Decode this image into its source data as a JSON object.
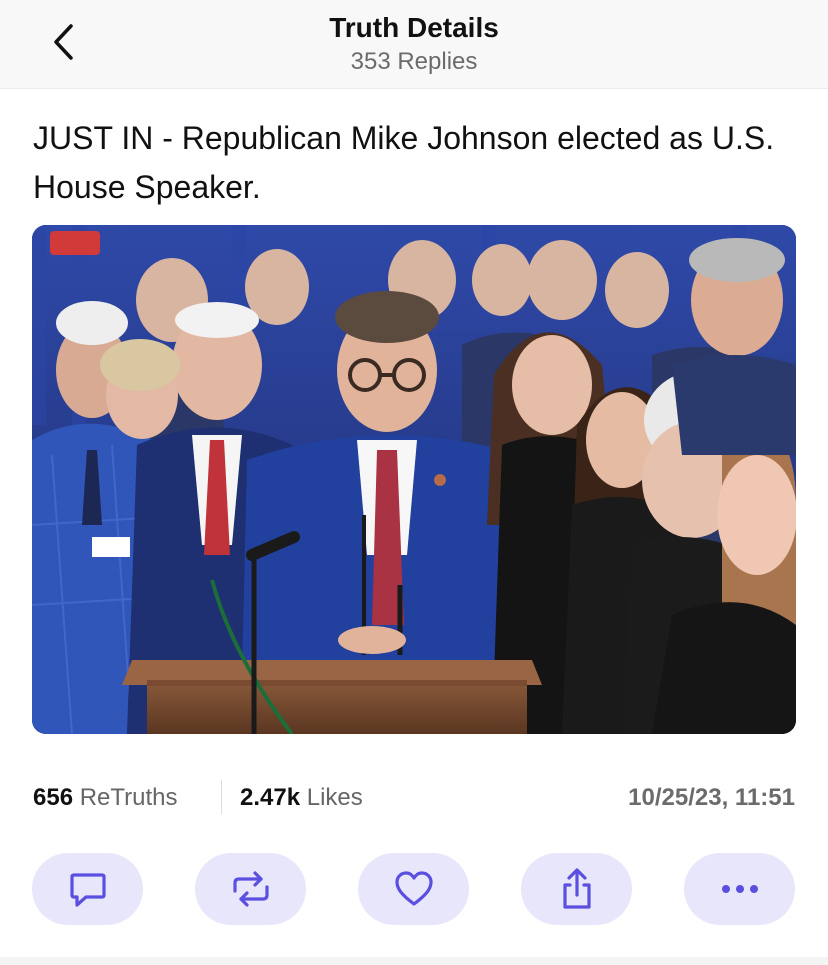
{
  "header": {
    "title": "Truth Details",
    "subtitle": "353 Replies",
    "back_icon": "chevron-left-icon"
  },
  "post": {
    "text": "JUST IN - Republican Mike Johnson elected as U.S. House Speaker.",
    "image_subject": "photo"
  },
  "stats": {
    "retruths_count": "656",
    "retruths_label": "ReTruths",
    "likes_count": "2.47k",
    "likes_label": "Likes",
    "timestamp": "10/25/23, 11:51"
  },
  "actions": [
    {
      "name": "reply",
      "icon": "comment-icon"
    },
    {
      "name": "retruth",
      "icon": "repost-icon"
    },
    {
      "name": "like",
      "icon": "heart-icon"
    },
    {
      "name": "share",
      "icon": "share-icon"
    },
    {
      "name": "more",
      "icon": "more-icon"
    }
  ],
  "colors": {
    "accent": "#5b4fe0",
    "action_bg": "#e7e6fb",
    "header_bg": "#f8f8f8"
  }
}
